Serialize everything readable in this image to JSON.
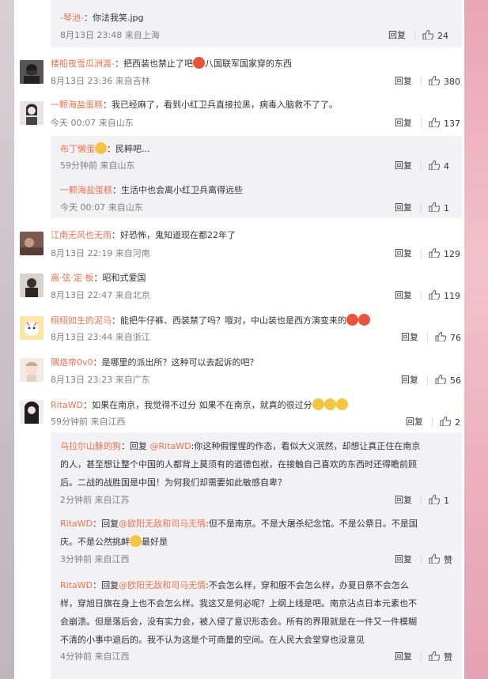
{
  "comments": [
    {
      "user": "-琴池-",
      "text": "：你法我笑.jpg",
      "time": "8月13日 23:48 来自上海",
      "reply": "回复",
      "likes": "24"
    },
    {
      "user": "楼船夜雪瓜洲渡-",
      "text": "：把西装也禁止了吧",
      "text2": "八国联军国家穿的东西",
      "time": "8月13日 23:36 来自吉林",
      "reply": "回复",
      "likes": "380"
    },
    {
      "user": "一颗海盐蛋糕",
      "text": "：我已经麻了，看到小红卫兵直接拉黑，病毒入脑救不了了。",
      "time": "今天 00:07 来自山东",
      "reply": "回复",
      "likes": "137"
    },
    {
      "user": "布丁懒蛋",
      "text": "：民粹吧...",
      "time": "59分钟前 来自山东",
      "reply": "回复",
      "likes": "4"
    },
    {
      "user": "一颗海盐蛋糕",
      "text": "：生活中也会离小红卫兵离得远些",
      "time": "今天 00:07 来自山东",
      "reply": "回复",
      "likes": "1"
    },
    {
      "user": "江南无风也无雨",
      "text": "：好恐怖，鬼知道现在都22年了",
      "time": "8月13日 22:19 来自河南",
      "reply": "回复",
      "likes": "129"
    },
    {
      "user": "嵩·弦·定·板",
      "text": "：昭和式爱国",
      "time": "8月13日 22:47 来自北京",
      "reply": "回复",
      "likes": "119"
    },
    {
      "user": "栩栩如生的泥马",
      "text": "：能把牛仔裤、西装禁了吗？哦对，中山装也是西方演变来的",
      "time": "8月13日 23:44 来自浙江",
      "reply": "回复",
      "likes": "76"
    },
    {
      "user": "隅烙帝0v0",
      "text": "：是哪里的派出所？这种可以去起诉的吧？",
      "time": "8月13日 23:23 来自广东",
      "reply": "回复",
      "likes": "56"
    },
    {
      "user": "RitaWD",
      "text": "：如果在南京，我觉得不过分 如果不在南京，就真的很过分",
      "time": "59分钟前 来自江西",
      "reply": "回复",
      "likes": "2"
    },
    {
      "user": "乌拉尔山脉的狗",
      "prefix": "：回复 ",
      "mention": "@RitaWD",
      "text_lines": [
        ":你这种假惺惺的作态，看似大义泯然，却想让真正住在南京",
        "的人，甚至想让整个中国的人都背上莫须有的道德包袱，在接触自己喜欢的东西时还得瞻前顾",
        "后。二战的战胜国是中国！为何我们却需要如此敏感自卑？"
      ],
      "time": "2分钟前 来自江苏",
      "reply": "回复",
      "likes": "1"
    },
    {
      "user": "RitaWD",
      "prefix": "：回复",
      "mention": "@欧阳无敌和司马无情",
      "text_lines": [
        ":但不是南京。不是大屠杀纪念馆。不是公祭日。不是国",
        "庆。不是公然挑衅",
        "最好是"
      ],
      "time": "3分钟前 来自江西",
      "reply": "回复",
      "likes": "赞"
    },
    {
      "user": "RitaWD",
      "prefix": "：回复",
      "mention": "@欧阳无敌和司马无情",
      "text_lines": [
        ":不会怎么样，穿和服不会怎么样，办夏日祭不会怎么",
        "样，穿旭日旗在身上也不会怎么样。我这又是何必呢？上纲上线是吧。南京沾点日本元素也不",
        "会崩溃。但是落后会，没有实力会，被入侵了意识形态会。所有的界限就是在一件又一件模糊",
        "不清的小事中退后的。我不认为这是个可商量的空间。在人民大会堂穿也没意见"
      ],
      "time": "4分钟前 来自江西",
      "reply": "回复",
      "likes": "赞"
    }
  ],
  "colors": {
    "username": "#eb7350",
    "mention": "#eb7350",
    "meta": "#808080",
    "reply_bg": "#f2f2f5"
  }
}
